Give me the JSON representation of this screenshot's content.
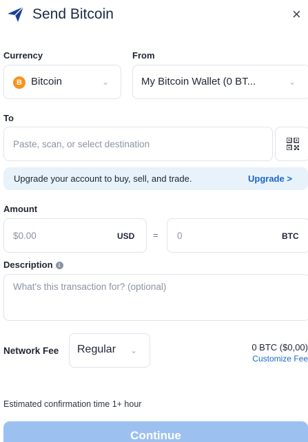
{
  "header": {
    "title": "Send Bitcoin",
    "close_glyph": "×",
    "send_icon": "paper-plane-icon",
    "accent": "#1b3f8f"
  },
  "currency": {
    "label": "Currency",
    "selected": "Bitcoin",
    "icon": "bitcoin-icon",
    "icon_color": "#f7931a"
  },
  "from": {
    "label": "From",
    "selected": "My Bitcoin Wallet (0 BT..."
  },
  "to": {
    "label": "To",
    "placeholder": "Paste, scan, or select destination",
    "qr_icon": "qr-code-icon"
  },
  "upgrade": {
    "text": "Upgrade your account to buy, sell, and trade.",
    "link": "Upgrade >",
    "background": "#e8f2fb",
    "link_color": "#1b67c9"
  },
  "amount": {
    "label": "Amount",
    "usd_placeholder": "$0.00",
    "usd_unit": "USD",
    "equals": "=",
    "btc_placeholder": "0",
    "btc_unit": "BTC"
  },
  "description": {
    "label": "Description",
    "info_glyph": "i",
    "placeholder": "What's this transaction for? (optional)"
  },
  "fee": {
    "label": "Network Fee",
    "selected": "Regular",
    "amount": "0 BTC ($0,00)",
    "customize": "Customize Fee"
  },
  "estimate": "Estimated confirmation time 1+ hour",
  "continue": {
    "label": "Continue",
    "color": "#9cc1f0"
  }
}
